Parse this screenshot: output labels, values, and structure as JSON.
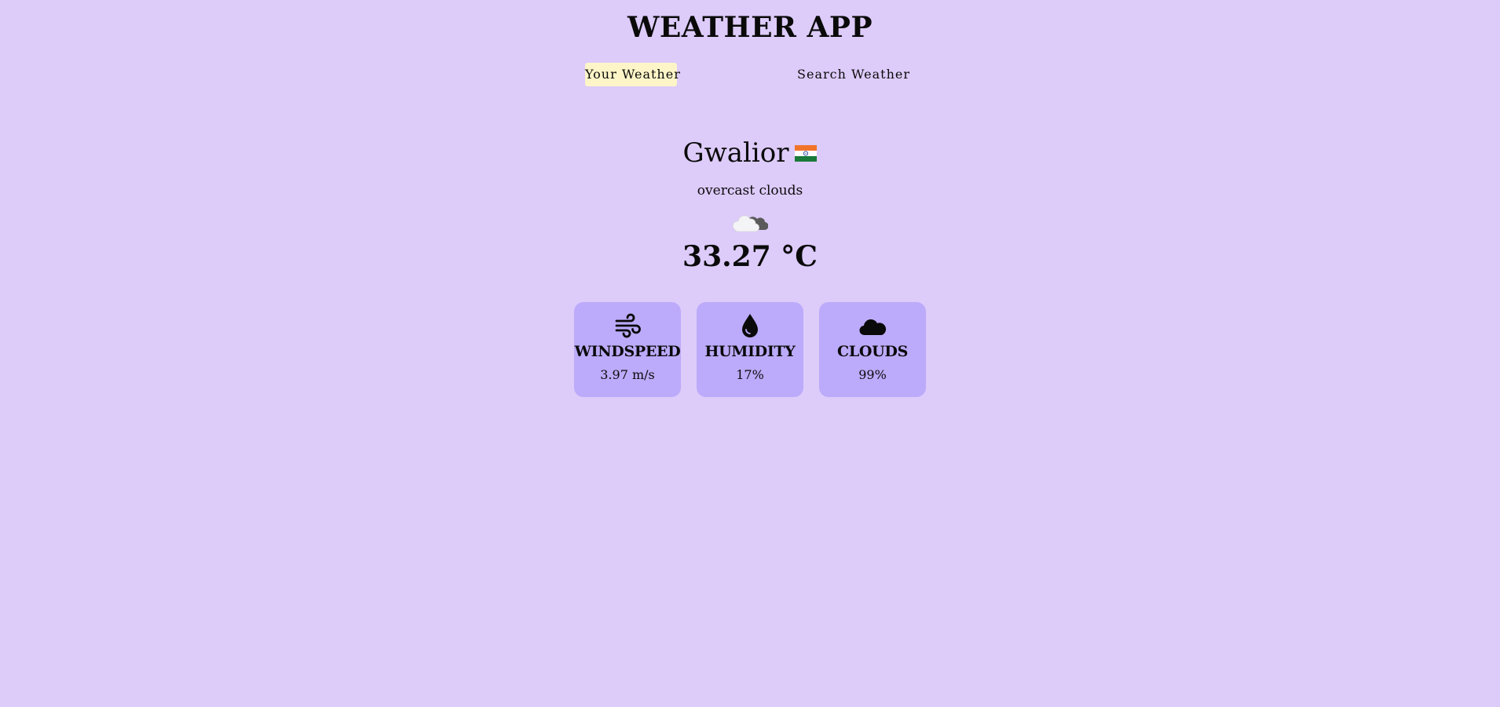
{
  "app": {
    "title": "WEATHER APP"
  },
  "tabs": [
    {
      "label": "Your Weather",
      "active": true
    },
    {
      "label": "Search Weather",
      "active": false
    }
  ],
  "current": {
    "city": "Gwalior",
    "country_flag_icon": "india-flag-icon",
    "description": "overcast clouds",
    "condition_icon": "overcast-clouds-icon",
    "temperature": "33.27 °C"
  },
  "stats": [
    {
      "label": "WINDSPEED",
      "value": "3.97 m/s",
      "icon": "wind-icon"
    },
    {
      "label": "HUMIDITY",
      "value": "17%",
      "icon": "water-drop-icon"
    },
    {
      "label": "CLOUDS",
      "value": "99%",
      "icon": "cloud-icon"
    }
  ],
  "colors": {
    "background": "#ddcbfa",
    "card": "#bcaafa",
    "active_tab": "#fdf5c8",
    "text": "#0a0a0a"
  }
}
